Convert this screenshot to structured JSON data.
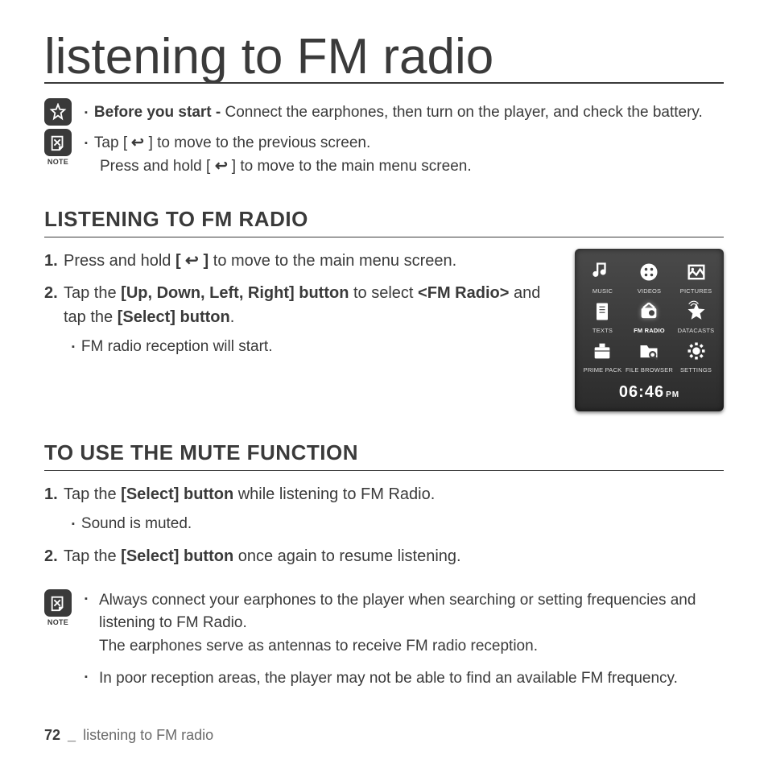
{
  "title": "listening to FM radio",
  "intro": {
    "star_prefix": "Before you start - ",
    "star_text": "Connect the earphones, then turn on the player, and check the battery.",
    "note_label": "NOTE",
    "note_line1_a": "Tap [ ",
    "note_line1_b": " ] to move to the previous screen.",
    "note_line2_a": "Press and hold [ ",
    "note_line2_b": " ] to move to the main menu screen."
  },
  "section1": {
    "heading": "LISTENING TO FM RADIO",
    "step1_a": "Press and hold ",
    "step1_b": "[",
    "step1_c": "]",
    "step1_d": " to move to the main menu screen.",
    "step2_a": "Tap the ",
    "step2_b": "[Up, Down, Left, Right] button",
    "step2_c": " to select ",
    "step2_d": "<FM Radio>",
    "step2_e": " and tap the ",
    "step2_f": "[Select] button",
    "step2_g": ".",
    "sub1": "FM radio reception will start."
  },
  "device": {
    "items": [
      "MUSIC",
      "VIDEOS",
      "PICTURES",
      "TEXTS",
      "FM RADIO",
      "DATACASTS",
      "PRIME PACK",
      "FILE BROWSER",
      "SETTINGS"
    ],
    "selected": 4,
    "time": "06:46",
    "ampm": "PM"
  },
  "section2": {
    "heading": "TO USE THE MUTE FUNCTION",
    "step1_a": "Tap the ",
    "step1_b": "[Select] button",
    "step1_c": " while listening to FM Radio.",
    "sub1": "Sound is muted.",
    "step2_a": "Tap the ",
    "step2_b": "[Select] button",
    "step2_c": " once again to resume listening."
  },
  "note2": {
    "label": "NOTE",
    "b1_a": "Always connect your earphones to the player when searching or setting frequencies and listening to FM Radio.",
    "b1_b": "The earphones serve as antennas to receive FM radio reception.",
    "b2": "In poor reception areas, the player may not be able to find an available FM frequency."
  },
  "footer": {
    "page": "72",
    "sep": "_",
    "chap": "listening to FM radio"
  }
}
